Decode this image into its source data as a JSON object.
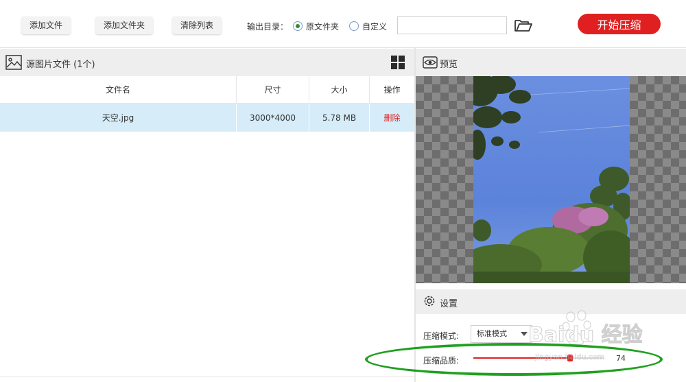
{
  "toolbar": {
    "add_file": "添加文件",
    "add_folder": "添加文件夹",
    "clear_list": "清除列表",
    "output_label": "输出目录：",
    "opt_original": "原文件夹",
    "opt_custom": "自定义",
    "dir_value": "",
    "start": "开始压缩"
  },
  "source": {
    "title": "源图片文件 (1个)",
    "columns": [
      "文件名",
      "尺寸",
      "大小",
      "操作"
    ],
    "rows": [
      {
        "name": "天空.jpg",
        "dimensions": "3000*4000",
        "size": "5.78 MB",
        "action": "删除"
      }
    ]
  },
  "preview": {
    "title": "预览"
  },
  "settings": {
    "title": "设置",
    "mode_label": "压缩模式:",
    "mode_value": "标准模式",
    "quality_label": "压缩品质:",
    "quality_value": "74",
    "quality_percent": 74
  },
  "watermark": {
    "text": "Baidu 经验",
    "sub": "jingyan.baidu.com"
  },
  "colors": {
    "accent": "#e02020",
    "selected_row": "#d6ecf9",
    "annotation": "#20a020"
  }
}
